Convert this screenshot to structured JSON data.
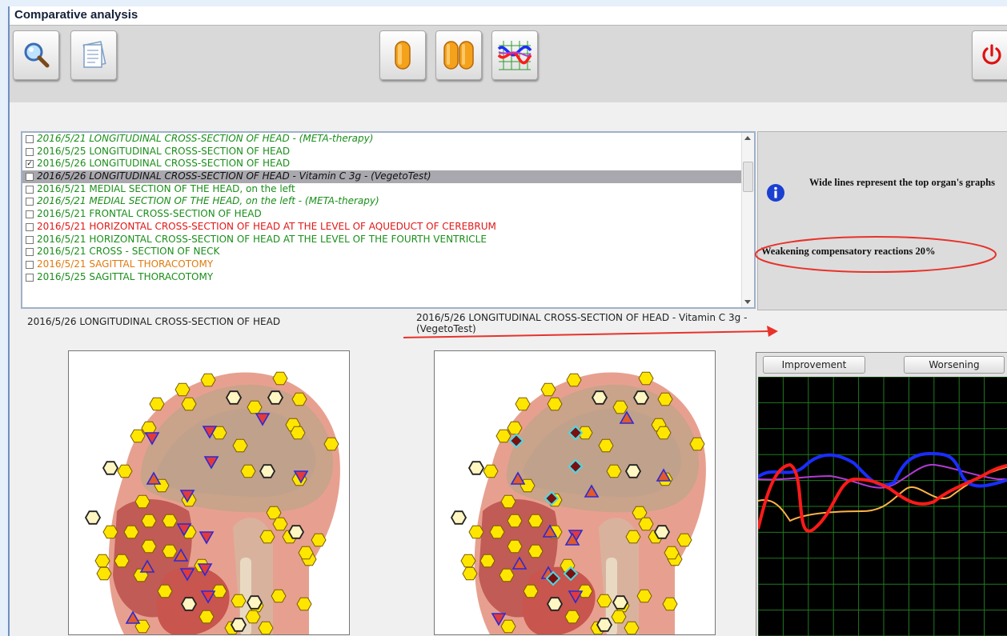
{
  "window": {
    "title": "Comparative analysis"
  },
  "toolbar": {
    "buttons": [
      {
        "name": "search",
        "icon": "magnifier-icon"
      },
      {
        "name": "report",
        "icon": "document-icon"
      },
      {
        "name": "single-view",
        "icon": "single-capsule-icon"
      },
      {
        "name": "double-view",
        "icon": "double-capsule-icon"
      },
      {
        "name": "graph-view",
        "icon": "line-graph-icon"
      },
      {
        "name": "power",
        "icon": "power-icon"
      }
    ]
  },
  "list": {
    "items": [
      {
        "checked": false,
        "italic": true,
        "color": "#1a8f1a",
        "text": "2016/5/21  LONGITUDINAL CROSS-SECTION OF HEAD - (META-therapy)"
      },
      {
        "checked": false,
        "italic": false,
        "color": "#1a8f1a",
        "text": "2016/5/25  LONGITUDINAL CROSS-SECTION OF HEAD"
      },
      {
        "checked": true,
        "italic": false,
        "color": "#1a8f1a",
        "text": "2016/5/26  LONGITUDINAL CROSS-SECTION OF HEAD"
      },
      {
        "checked": false,
        "italic": true,
        "color": "#111111",
        "selected": true,
        "text": "2016/5/26  LONGITUDINAL CROSS-SECTION OF HEAD - Vitamin C 3g - (VegetoTest)"
      },
      {
        "checked": false,
        "italic": false,
        "color": "#1a8f1a",
        "text": "2016/5/21  MEDIAL SECTION OF THE HEAD, on the left"
      },
      {
        "checked": false,
        "italic": true,
        "color": "#1a8f1a",
        "text": "2016/5/21  MEDIAL SECTION OF THE HEAD, on the left - (META-therapy)"
      },
      {
        "checked": false,
        "italic": false,
        "color": "#1a8f1a",
        "text": "2016/5/21  FRONTAL CROSS-SECTION OF HEAD"
      },
      {
        "checked": false,
        "italic": false,
        "color": "#e01818",
        "text": "2016/5/21  HORIZONTAL CROSS-SECTION OF HEAD AT THE LEVEL OF AQUEDUCT OF CEREBRUM"
      },
      {
        "checked": false,
        "italic": false,
        "color": "#1a8f1a",
        "text": "2016/5/21  HORIZONTAL CROSS-SECTION OF HEAD AT THE LEVEL OF THE FOURTH VENTRICLE"
      },
      {
        "checked": false,
        "italic": false,
        "color": "#1a8f1a",
        "text": "2016/5/21  CROSS - SECTION OF NECK"
      },
      {
        "checked": false,
        "italic": false,
        "color": "#e07b10",
        "text": "2016/5/21  SAGITTAL THORACOTOMY"
      },
      {
        "checked": false,
        "italic": false,
        "color": "#1a8f1a",
        "text": "2016/5/25  SAGITTAL THORACOTOMY"
      }
    ]
  },
  "info": {
    "icon": "info-icon",
    "message": "Wide lines represent the top organ's graphs",
    "status": "Weakening compensatory reactions 20%"
  },
  "captions": {
    "left": "2016/5/26  LONGITUDINAL CROSS-SECTION OF HEAD",
    "right": "2016/5/26  LONGITUDINAL CROSS-SECTION OF HEAD - Vitamin C 3g - (VegetoTest)"
  },
  "graph": {
    "improvement_label": "Improvement",
    "worsening_label": "Worsening",
    "series": [
      {
        "color": "#ff1a1a",
        "width": 4
      },
      {
        "color": "#1a2dff",
        "width": 4
      },
      {
        "color": "#b23bd6",
        "width": 2
      },
      {
        "color": "#ffb347",
        "width": 2
      }
    ]
  },
  "colors": {
    "marker_yellow": "#ffe600",
    "marker_light": "#fff6c2",
    "marker_triangle": "#e05a2a",
    "marker_blue": "#2a2ad8",
    "marker_diamond": "#7a1010",
    "annotation_red": "#e8322a"
  }
}
